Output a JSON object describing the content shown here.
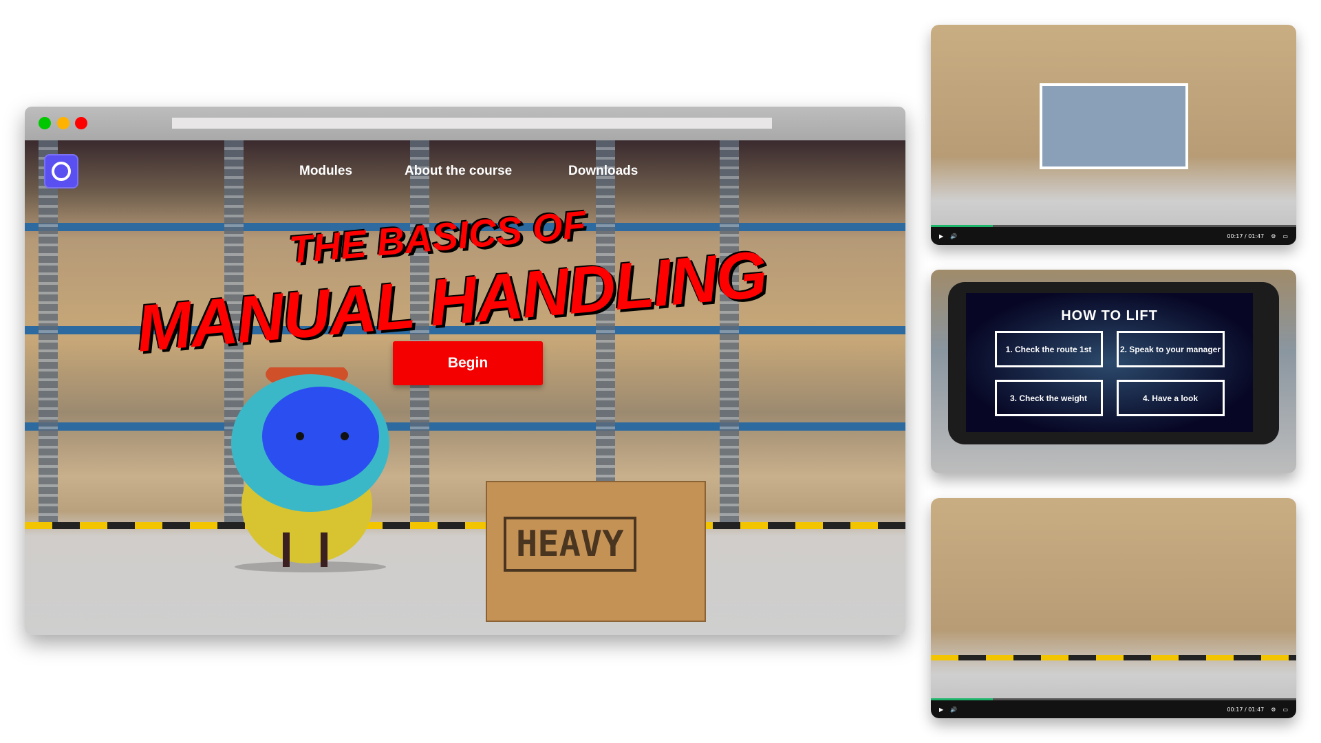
{
  "browser": {
    "dots": [
      "#00c800",
      "#ffb300",
      "#ff0000"
    ]
  },
  "nav": {
    "items": [
      "Modules",
      "About the course",
      "Downloads"
    ]
  },
  "hero": {
    "title_line1": "THE BASICS OF",
    "title_line2": "MANUAL HANDLING",
    "begin_label": "Begin",
    "box_label": "HEAVY"
  },
  "video": {
    "time": "00:17 / 01:47",
    "progress": 0.17
  },
  "quiz": {
    "title": "HOW TO LIFT",
    "options": [
      "1. Check the route 1st",
      "2. Speak to your manager",
      "3. Check the weight",
      "4. Have a look"
    ]
  },
  "colors": {
    "accent": "#f40000",
    "logo": "#5a4ff0",
    "progress": "#1db56a"
  }
}
